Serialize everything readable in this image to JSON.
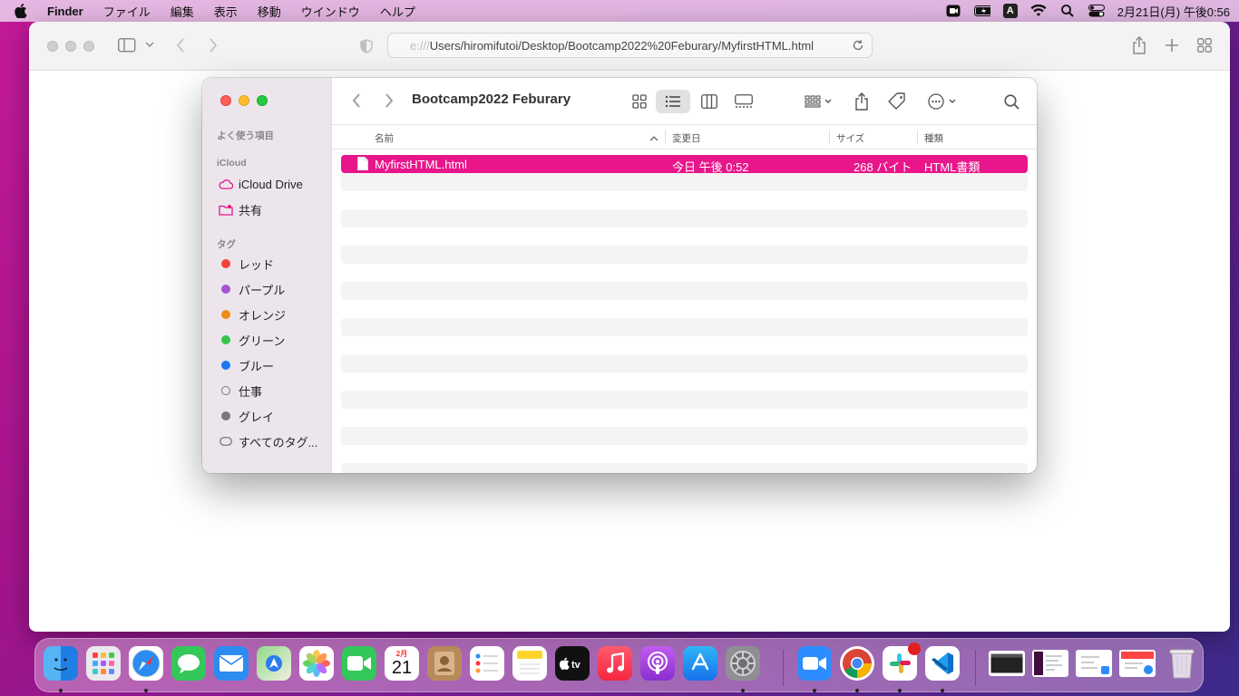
{
  "menubar": {
    "app": "Finder",
    "items": [
      "ファイル",
      "編集",
      "表示",
      "移動",
      "ウインドウ",
      "ヘルプ"
    ],
    "input_mode": "A",
    "clock": "2月21日(月) 午後0:56"
  },
  "safari": {
    "url_faded": "e:///",
    "url": "Users/hiromifutoi/Desktop/Bootcamp2022%20Feburary/MyfirstHTML.html"
  },
  "finder": {
    "title": "Bootcamp2022 Feburary",
    "sidebar": {
      "favorites_header": "よく使う項目",
      "icloud_header": "iCloud",
      "icloud_drive": "iCloud Drive",
      "shared": "共有",
      "tags_header": "タグ",
      "tags": [
        {
          "label": "レッド",
          "color": "#f0443c"
        },
        {
          "label": "パープル",
          "color": "#a454d0"
        },
        {
          "label": "オレンジ",
          "color": "#f08a18"
        },
        {
          "label": "グリーン",
          "color": "#34c44a"
        },
        {
          "label": "ブルー",
          "color": "#1e78f0"
        },
        {
          "label": "仕事",
          "color": "none"
        },
        {
          "label": "グレイ",
          "color": "#7a777a"
        },
        {
          "label": "すべてのタグ...",
          "color": "all"
        }
      ]
    },
    "columns": {
      "name": "名前",
      "modified": "変更日",
      "size": "サイズ",
      "kind": "種類"
    },
    "files": [
      {
        "name": "MyfirstHTML.html",
        "modified": "今日 午後 0:52",
        "size": "268 バイト",
        "kind": "HTML書類"
      }
    ],
    "accent": "#e8168a"
  },
  "dock": {
    "calendar_month": "2月",
    "calendar_day": "21",
    "apps": [
      "finder-icon",
      "launchpad-icon",
      "safari-icon",
      "messages-icon",
      "mail-icon",
      "maps-icon",
      "photos-icon",
      "facetime-icon",
      "calendar-icon",
      "contacts-icon",
      "reminders-icon",
      "notes-icon",
      "appletv-icon",
      "music-icon",
      "podcasts-icon",
      "appstore-icon",
      "system-preferences-icon",
      "zoom-icon",
      "chrome-icon",
      "slack-icon",
      "vscode-icon"
    ]
  }
}
